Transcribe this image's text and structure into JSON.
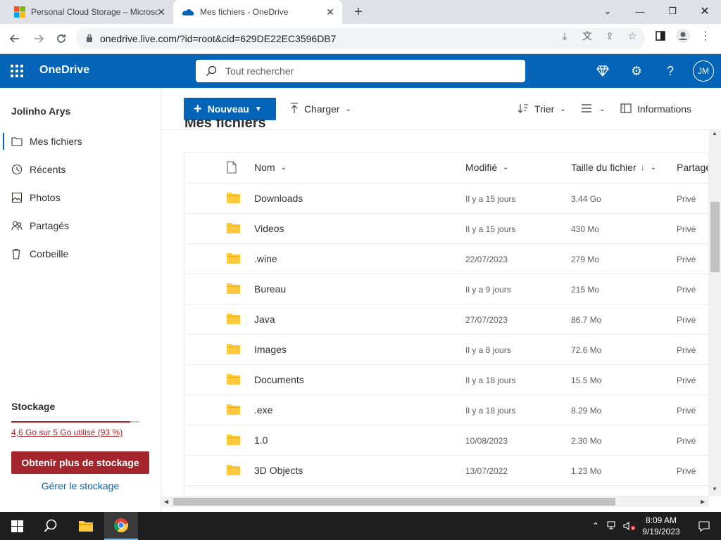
{
  "browser": {
    "tabs": [
      {
        "title": "Personal Cloud Storage – Microsoft",
        "active": false
      },
      {
        "title": "Mes fichiers - OneDrive",
        "active": true
      }
    ],
    "url": "onedrive.live.com/?id=root&cid=629DE22EC3596DB7"
  },
  "header": {
    "brand": "OneDrive",
    "search_placeholder": "Tout rechercher",
    "avatar_initials": "JM"
  },
  "sidebar": {
    "user": "Jolinho Arys",
    "items": [
      {
        "label": "Mes fichiers",
        "icon": "folder-icon",
        "active": true
      },
      {
        "label": "Récents",
        "icon": "recent-icon",
        "active": false
      },
      {
        "label": "Photos",
        "icon": "photos-icon",
        "active": false
      },
      {
        "label": "Partagés",
        "icon": "shared-icon",
        "active": false
      },
      {
        "label": "Corbeille",
        "icon": "recycle-bin-icon",
        "active": false
      }
    ],
    "storage": {
      "title": "Stockage",
      "usage_text": "4,6 Go sur 5 Go utilisé (93 %)",
      "percent_used": 93,
      "get_more": "Obtenir plus de stockage",
      "manage": "Gérer le stockage"
    }
  },
  "commandbar": {
    "new": "Nouveau",
    "upload": "Charger",
    "sort": "Trier",
    "info": "Informations"
  },
  "page_title": "Mes fichiers",
  "list": {
    "columns": {
      "name": "Nom",
      "modified": "Modifié",
      "size": "Taille du fichier",
      "sharing": "Partage"
    },
    "rows": [
      {
        "name": "Downloads",
        "modified": "Il y a 15 jours",
        "size": "3.44 Go",
        "sharing": "Privé"
      },
      {
        "name": "Videos",
        "modified": "Il y a 15 jours",
        "size": "430 Mo",
        "sharing": "Privé"
      },
      {
        "name": ".wine",
        "modified": "22/07/2023",
        "size": "279 Mo",
        "sharing": "Privé"
      },
      {
        "name": "Bureau",
        "modified": "Il y a 9 jours",
        "size": "215 Mo",
        "sharing": "Privé"
      },
      {
        "name": "Java",
        "modified": "27/07/2023",
        "size": "86.7 Mo",
        "sharing": "Privé"
      },
      {
        "name": "Images",
        "modified": "Il y a 8 jours",
        "size": "72.6 Mo",
        "sharing": "Privé"
      },
      {
        "name": "Documents",
        "modified": "Il y a 18 jours",
        "size": "15.5 Mo",
        "sharing": "Privé"
      },
      {
        "name": ".exe",
        "modified": "Il y a 18 jours",
        "size": "8.29 Mo",
        "sharing": "Privé"
      },
      {
        "name": "1.0",
        "modified": "10/08/2023",
        "size": "2.30 Mo",
        "sharing": "Privé"
      },
      {
        "name": "3D Objects",
        "modified": "13/07/2022",
        "size": "1.23 Mo",
        "sharing": "Privé"
      }
    ]
  },
  "taskbar": {
    "time": "8:09 AM",
    "date": "9/19/2023"
  },
  "colors": {
    "brand_blue": "#0364b8",
    "storage_red": "#a4262c",
    "folder_yellow": "#ffc83d"
  }
}
